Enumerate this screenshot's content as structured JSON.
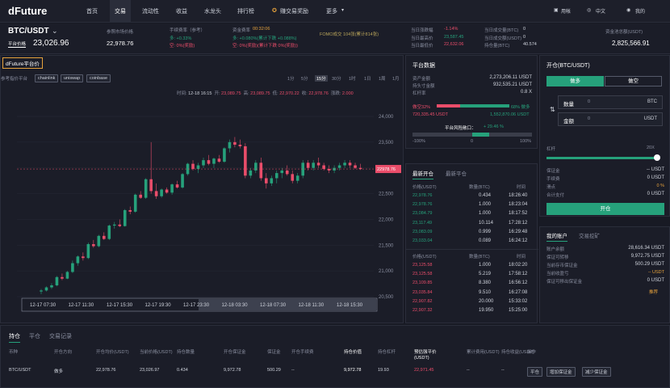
{
  "nav": {
    "logo": "dFuture",
    "items": [
      "首页",
      "交易",
      "流动性",
      "收益",
      "水龙头",
      "排行榜",
      "赚交易奖励",
      "更多"
    ],
    "apply": "用帐",
    "lang": "中文",
    "account": "我的"
  },
  "ticker": {
    "pair": "BTC/USDT",
    "pair_sub": "平台价格",
    "price": "23,026.96",
    "spot_label": "参照市场价格",
    "spot_value": "22,978.76",
    "fee_label": "手续费率（参考）",
    "fee_long": "多: +0.33%",
    "fee_short": "空: 0%(奖励)",
    "fund_label": "资金费率",
    "fund_time": "00:32:06",
    "fund_long": "多: +0.080%(累计下跌 +0.088%)",
    "fund_short": "空: 0%(奖励)(累计下跌 0%(奖励))",
    "fomo": "FOMO成交 104张(累计814张)",
    "h_label": "当日涨跌幅",
    "h_value": "-1.14%",
    "hi_label": "当日最高价",
    "hi_value": "23,587.45",
    "lo_label": "当日最低价",
    "lo_value": "22,632.06",
    "vol_label": "当日成交量(BTC)",
    "vol_value": "0",
    "amt_label": "当日成交额(USDT)",
    "amt_value": "0",
    "pos_label": "持仓量(BTC)",
    "pos_value": "40.574",
    "pool_label": "资金池总额(USDT)",
    "pool_value": "2,825,566.91"
  },
  "chart_tab": "dFuture平台价",
  "chart_tools": {
    "ref": "参考指价平台",
    "sources": [
      "chainlink",
      "uniswap",
      "coinbase"
    ],
    "intervals": [
      "1分",
      "5分",
      "15分",
      "30分",
      "1时",
      "1日",
      "1周",
      "1月"
    ]
  },
  "chart_info": {
    "time_l": "时间:",
    "time": "12-18 16:15",
    "open_l": "开:",
    "open": "23,089.75",
    "high_l": "高:",
    "high": "23,089.75",
    "low_l": "低:",
    "low": "22,970.22",
    "close_l": "收:",
    "close": "22,978.76",
    "chg_l": "涨跌:",
    "chg": "2.000"
  },
  "chart_data": {
    "type": "candlestick",
    "y_ticks": [
      "24,000",
      "23,500",
      "23,000",
      "22,500",
      "22,000",
      "21,500",
      "21,000",
      "20,500"
    ],
    "y_min": 20500,
    "y_max": 24000,
    "last": 22978.76,
    "last_label": "22978.76",
    "x_ticks": [
      "12-17 07:30",
      "12-17 11:30",
      "12-17 15:30",
      "12-17 19:30",
      "12-17 23:30",
      "12-18 03:30",
      "12-18 07:30",
      "12-18 11:30",
      "12-18 15:30"
    ],
    "candles": [
      [
        20600,
        20650,
        20550,
        20620
      ],
      [
        20620,
        20700,
        20600,
        20680
      ],
      [
        20680,
        20760,
        20650,
        20720
      ],
      [
        20720,
        20900,
        20700,
        20880
      ],
      [
        20880,
        20950,
        20820,
        20850
      ],
      [
        20850,
        21000,
        20840,
        20980
      ],
      [
        20980,
        21200,
        20960,
        21150
      ],
      [
        21150,
        21300,
        21100,
        21280
      ],
      [
        21280,
        21360,
        21200,
        21250
      ],
      [
        21250,
        21550,
        21230,
        21520
      ],
      [
        21520,
        21600,
        21450,
        21480
      ],
      [
        21480,
        21700,
        21460,
        21680
      ],
      [
        21680,
        21750,
        21600,
        21620
      ],
      [
        21620,
        21900,
        21600,
        21880
      ],
      [
        21880,
        21950,
        21820,
        21900
      ],
      [
        21900,
        22000,
        21850,
        21870
      ],
      [
        21870,
        22200,
        21860,
        22180
      ],
      [
        22180,
        22250,
        22100,
        22150
      ],
      [
        22150,
        22500,
        22130,
        22480
      ],
      [
        22480,
        22550,
        22400,
        22420
      ],
      [
        22420,
        22800,
        22400,
        22780
      ],
      [
        22780,
        23500,
        22500,
        22550
      ],
      [
        22550,
        22700,
        22400,
        22450
      ],
      [
        22450,
        22600,
        22420,
        22580
      ],
      [
        22580,
        22620,
        22500,
        22520
      ],
      [
        22520,
        22700,
        22480,
        22680
      ],
      [
        22680,
        22750,
        22600,
        22620
      ],
      [
        22620,
        22900,
        22600,
        22880
      ],
      [
        22880,
        23100,
        22850,
        23080
      ],
      [
        23080,
        23150,
        22950,
        22980
      ],
      [
        22980,
        23100,
        22900,
        23050
      ],
      [
        23050,
        23200,
        23000,
        23150
      ],
      [
        23150,
        23250,
        23050,
        23080
      ],
      [
        23080,
        23200,
        23000,
        23180
      ],
      [
        23180,
        23250,
        23100,
        23120
      ],
      [
        23120,
        23400,
        23100,
        23380
      ],
      [
        23380,
        23550,
        23300,
        23500
      ],
      [
        23500,
        23600,
        23400,
        23450
      ],
      [
        23450,
        23550,
        23380,
        23420
      ],
      [
        23420,
        23480,
        22800,
        22850
      ],
      [
        22850,
        23000,
        22800,
        22950
      ],
      [
        22950,
        23150,
        22900,
        23100
      ],
      [
        23100,
        23200,
        22750,
        22800
      ],
      [
        22800,
        22900,
        22600,
        22700
      ],
      [
        22700,
        22850,
        22650,
        22800
      ],
      [
        22800,
        22950,
        22700,
        22900
      ],
      [
        22900,
        23000,
        22800,
        22950
      ],
      [
        22950,
        23050,
        22850,
        22880
      ],
      [
        22880,
        22950,
        22700,
        22750
      ],
      [
        22750,
        22900,
        22700,
        22850
      ],
      [
        22850,
        23150,
        22800,
        23100
      ],
      [
        23100,
        23150,
        22950,
        23000
      ],
      [
        23000,
        23150,
        22950,
        23100
      ],
      [
        23100,
        23200,
        23000,
        23050
      ],
      [
        23050,
        23100,
        22950,
        22980
      ],
      [
        22980,
        23050,
        22900,
        22950
      ],
      [
        22950,
        23050,
        22900,
        23000
      ],
      [
        23000,
        23100,
        22950,
        23050
      ],
      [
        23050,
        23150,
        23000,
        23100
      ],
      [
        23100,
        23150,
        23000,
        23050
      ],
      [
        23050,
        23100,
        22980,
        23000
      ],
      [
        23000,
        23080,
        22960,
        22978
      ]
    ]
  },
  "platform": {
    "title": "平台数据",
    "rows": [
      [
        "资产金额",
        "2,273,206.11 USDT"
      ],
      [
        "持头寸金额",
        "932,535.21 USDT"
      ],
      [
        "杠杆率",
        "0.8 X"
      ]
    ],
    "short_label": "做空",
    "short_pct": "32%",
    "long_label": "做多",
    "long_pct": "68%",
    "short_val": "720,335.45 USDT",
    "long_val": "1,552,870.06 USDT",
    "risk_label": "平台风险敞口：",
    "risk_val": "+ 29.46 %",
    "risk_fill": 0.64,
    "risk_ticks": [
      "-100%",
      "0",
      "100%"
    ]
  },
  "trades": {
    "tab1": "最新开仓",
    "tab2": "最新平仓",
    "headers": [
      "价格(USDT)",
      "数量(BTC)",
      "时间"
    ],
    "open": [
      [
        "22,978.76",
        "0.434",
        "18:26:40",
        "g"
      ],
      [
        "22,978.76",
        "1.000",
        "18:23:04",
        "g"
      ],
      [
        "23,084.79",
        "1.000",
        "18:17:52",
        "g"
      ],
      [
        "23,117.49",
        "10.114",
        "17:28:12",
        "g"
      ],
      [
        "23,083.09",
        "0.999",
        "16:29:48",
        "g"
      ],
      [
        "23,033.04",
        "0.089",
        "16:24:12",
        "g"
      ]
    ],
    "close": [
      [
        "23,125.58",
        "1.000",
        "18:02:20",
        "r"
      ],
      [
        "23,125.58",
        "5.219",
        "17:58:12",
        "r"
      ],
      [
        "23,109.85",
        "8.380",
        "16:56:12",
        "r"
      ],
      [
        "23,035.84",
        "9.510",
        "16:27:08",
        "r"
      ],
      [
        "22,907.82",
        "20.000",
        "15:33:02",
        "r"
      ],
      [
        "22,907.32",
        "19.950",
        "15:25:00",
        "r"
      ]
    ]
  },
  "order": {
    "title": "开仓(BTC/USDT)",
    "buy": "做多",
    "sell": "做空",
    "qty_label": "数量",
    "qty_val": "0",
    "qty_unit": "BTC",
    "amt_label": "金额",
    "amt_val": "0",
    "amt_unit": "USDT",
    "lev_label": "杠杆",
    "lev_val": "20X",
    "lev_fill": 0.98,
    "info": [
      [
        "保证金",
        "-- USDT"
      ],
      [
        "手续费",
        "0 USDT"
      ],
      [
        "滑点",
        "0 %"
      ],
      [
        "合计支付",
        "0 USDT"
      ]
    ],
    "submit": "开仓"
  },
  "myacct": {
    "tab1": "我的账户",
    "tab2": "交易挖矿",
    "rows": [
      [
        "账户余额",
        "28,616.34 USDT"
      ],
      [
        "保证可转移",
        "9,972.75 USDT"
      ],
      [
        "当前存币保证金",
        "500.29 USDT"
      ],
      [
        "当前收盈亏",
        "-- USDT"
      ],
      [
        "保证可移出保证金",
        "0 USDT"
      ]
    ],
    "link": "推荐"
  },
  "positions": {
    "tabs": [
      "持仓",
      "平仓",
      "交易记录"
    ],
    "headers": [
      "币种",
      "开仓方向",
      "开仓均价(USDT)",
      "当前价格(USDT)",
      "持仓数量",
      "开仓保证金",
      "保证金",
      "开仓手续费",
      "持仓价值",
      "持仓杠杆",
      "预估强平价(USDT)",
      "累计费用(USDT)",
      "持仓收益(USDT)",
      "操作"
    ],
    "row": [
      "BTC/USDT",
      "做多",
      "22,978.76",
      "23,026.97",
      "0.434",
      "9,972.78",
      "500.29",
      "--",
      "9,972.78",
      "19.93",
      "22,971.45",
      "--",
      "--"
    ],
    "actions": [
      "平仓",
      "增加保证金",
      "减少保证金"
    ]
  }
}
